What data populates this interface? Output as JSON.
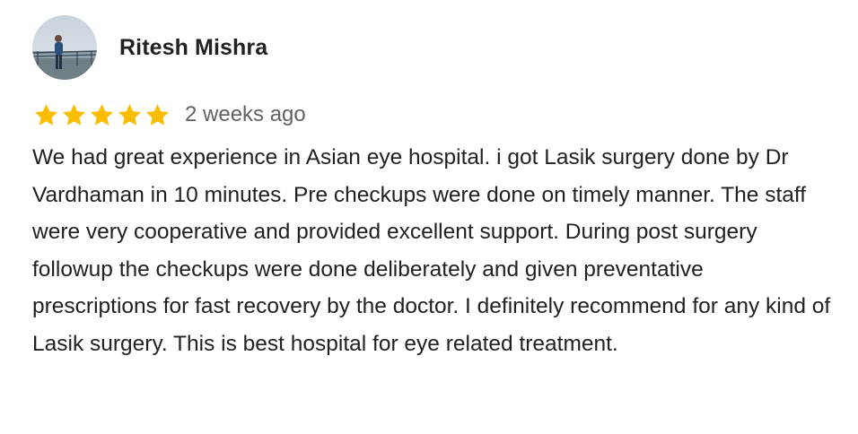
{
  "review": {
    "reviewer_name": "Ritesh Mishra",
    "avatar_icon": "reviewer-avatar-photo",
    "rating": 5,
    "rating_max": 5,
    "star_color": "#fbbc04",
    "time_ago": "2 weeks ago",
    "text": "We had great experience in Asian eye hospital. i got Lasik surgery done by Dr Vardhaman in 10 minutes. Pre checkups were done on timely manner. The staff were very cooperative and provided excellent support. During post surgery followup the checkups were done deliberately and given preventative prescriptions for fast recovery by the doctor. I definitely recommend for any kind of Lasik surgery. This is best hospital for eye related treatment."
  }
}
